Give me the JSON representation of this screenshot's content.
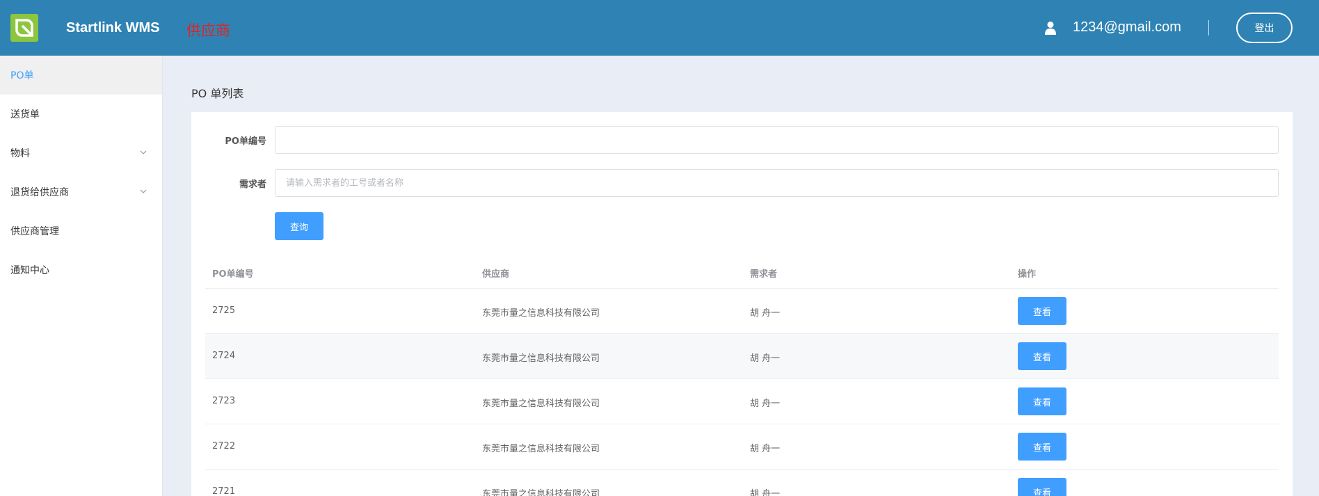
{
  "header": {
    "app_title": "Startlink WMS",
    "role": "供应商",
    "user_email": "1234@gmail.com",
    "logout_label": "登出"
  },
  "sidebar": {
    "items": [
      {
        "label": "PO单",
        "active": true
      },
      {
        "label": "送货单"
      },
      {
        "label": "物料",
        "expandable": true
      },
      {
        "label": "退货给供应商",
        "expandable": true
      },
      {
        "label": "供应商管理"
      },
      {
        "label": "通知中心"
      }
    ]
  },
  "main": {
    "page_title": "PO 单列表",
    "form": {
      "po_label": "PO单编号",
      "po_value": "",
      "requester_label": "需求者",
      "requester_placeholder": "请输入需求者的工号或者名称",
      "query_label": "查询"
    },
    "table": {
      "headers": [
        "PO单编号",
        "供应商",
        "需求者",
        "操作"
      ],
      "rows": [
        {
          "po": "2725",
          "supplier": "东莞市量之信息科技有限公司",
          "requester": "胡 舟一",
          "action": "查看"
        },
        {
          "po": "2724",
          "supplier": "东莞市量之信息科技有限公司",
          "requester": "胡 舟一",
          "action": "查看"
        },
        {
          "po": "2723",
          "supplier": "东莞市量之信息科技有限公司",
          "requester": "胡 舟一",
          "action": "查看"
        },
        {
          "po": "2722",
          "supplier": "东莞市量之信息科技有限公司",
          "requester": "胡 舟一",
          "action": "查看"
        },
        {
          "po": "2721",
          "supplier": "东莞市量之信息科技有限公司",
          "requester": "胡 舟一",
          "action": "查看"
        }
      ]
    }
  },
  "colors": {
    "header_bg": "#2e83b4",
    "logo_bg": "#8cc63f",
    "accent": "#409eff",
    "role_text": "#e02424"
  },
  "icons": {
    "logo": "leaf-logo-icon",
    "user": "user-icon",
    "chevron": "chevron-down-icon"
  }
}
